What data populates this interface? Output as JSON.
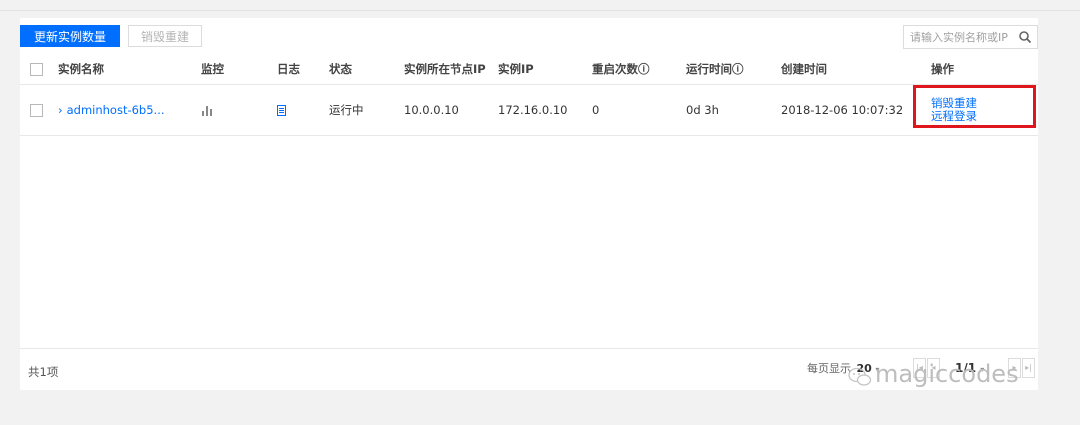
{
  "toolbar": {
    "update_button": "更新实例数量",
    "destroy_rebuild_button": "销毁重建",
    "search_placeholder": "请输入实例名称或IP"
  },
  "table": {
    "headers": [
      "实例名称",
      "监控",
      "日志",
      "状态",
      "实例所在节点IP",
      "实例IP",
      "重启次数ⓘ",
      "运行时间ⓘ",
      "创建时间",
      "操作"
    ],
    "rows": [
      {
        "name": "adminhost-6b5...",
        "status": "运行中",
        "node_ip": "10.0.0.10",
        "instance_ip": "172.16.0.10",
        "restarts": "0",
        "uptime": "0d 3h",
        "created": "2018-12-06 10:07:32",
        "op_destroy": "销毁重建",
        "op_remote": "远程登录"
      }
    ]
  },
  "footer": {
    "total": "共1项",
    "per_page_label": "每页显示",
    "per_page_value": "20",
    "page": "1/1"
  },
  "watermark": "magiccodes",
  "colors": {
    "primary": "#006eff",
    "running": "#0abf5b",
    "highlight_box": "#e0161e"
  }
}
